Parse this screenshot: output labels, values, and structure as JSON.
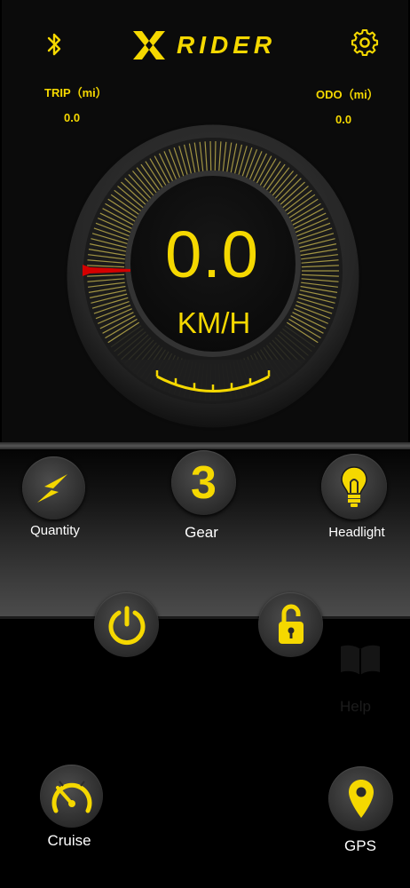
{
  "header": {
    "brand_text": "RIDER",
    "bluetooth_icon": "bluetooth-icon",
    "settings_icon": "gear-icon"
  },
  "trip": {
    "label": "TRIP（mi）",
    "value": "0.0"
  },
  "odo": {
    "label": "ODO（mi）",
    "value": "0.0"
  },
  "speedometer": {
    "speed": "0.0",
    "unit": "KM/H"
  },
  "controls": {
    "quantity_label": "Quantity",
    "gear_value": "3",
    "gear_label": "Gear",
    "headlight_label": "Headlight",
    "help_label": "Help",
    "cruise_label": "Cruise",
    "gps_label": "GPS"
  },
  "colors": {
    "accent": "#f5d800",
    "needle": "#d40000",
    "background": "#000000"
  }
}
